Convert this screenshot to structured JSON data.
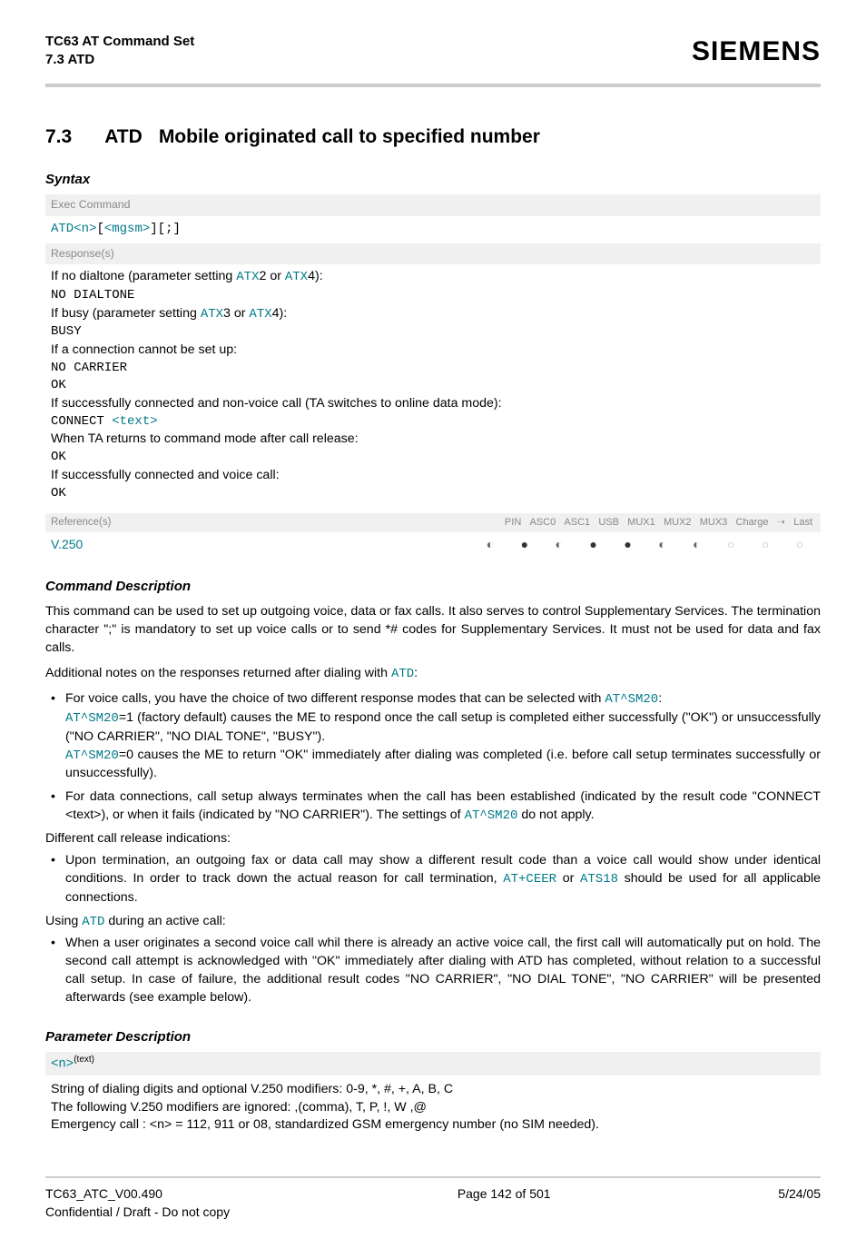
{
  "header": {
    "line1": "TC63 AT Command Set",
    "line2": "7.3 ATD",
    "brand": "SIEMENS"
  },
  "title": {
    "num": "7.3",
    "cmd": "ATD",
    "desc": "Mobile originated call to specified number"
  },
  "syntax_label": "Syntax",
  "exec_command_label": "Exec Command",
  "exec_command": {
    "cmd": "ATD",
    "p1": "<n>",
    "b1": "[",
    "p2": "<mgsm>",
    "b2": "][;]"
  },
  "responses_label": "Response(s)",
  "resp": {
    "l1a": "If no dialtone (parameter setting ",
    "l1b": "2 or ",
    "l1c": "4):",
    "atx": "ATX",
    "no_dialtone": "NO DIALTONE",
    "l2a": "If busy (parameter setting ",
    "l2b": "3 or ",
    "l2c": "4):",
    "busy": "BUSY",
    "l3": "If a connection cannot be set up:",
    "no_carrier": "NO CARRIER",
    "ok1": "OK",
    "l4": "If successfully connected and non-voice call (TA switches to online data mode):",
    "connect": "CONNECT ",
    "text_tag": "<text>",
    "l5": "When TA returns to command mode after call release:",
    "ok2": "OK",
    "l6": "If successfully connected and voice call:",
    "ok3": "OK"
  },
  "ref": {
    "label": "Reference(s)",
    "cols": [
      "PIN",
      "ASC0",
      "ASC1",
      "USB",
      "MUX1",
      "MUX2",
      "MUX3",
      "Charge",
      "➝",
      "Last"
    ],
    "name": "V.250",
    "vals": [
      "◐",
      "●",
      "◐",
      "●",
      "●",
      "◐",
      "◐",
      "○",
      "○",
      "○"
    ]
  },
  "cmd_desc_label": "Command Description",
  "cmd_desc_p1": "This command can be used to set up outgoing voice, data or fax calls. It also serves to control Supplementary Services. The termination character \";\" is mandatory to set up voice calls or to send *# codes for Supplementary Services. It must not be used for data and fax calls.",
  "cmd_desc_p2a": "Additional notes on the responses returned after dialing with ",
  "cmd_desc_p2b": ":",
  "atd": "ATD",
  "at_sm20": "AT^SM20",
  "at_ceer": "AT+CEER",
  "ats18": "ATS18",
  "bul1": {
    "a": "For voice calls, you have the choice of two different response modes that can be selected with ",
    "b": ":",
    "c": "=1 (factory default) causes the ME to respond once the call setup is completed either successfully (\"OK\") or unsuccessfully (\"NO CARRIER\", \"NO DIAL TONE\", \"BUSY\").",
    "d": "=0 causes the ME to return \"OK\" immediately after dialing was completed (i.e. before call setup terminates successfully or unsuccessfully)."
  },
  "bul2": {
    "a": "For data connections, call setup always terminates when the call has been established (indicated by the result code \"CONNECT <text>), or when it fails (indicated by \"NO CARRIER\"). The settings of ",
    "b": " do not apply."
  },
  "diff_rel": "Different call release indications:",
  "bul3": {
    "a": "Upon termination, an outgoing fax or data call may show a different result code than a voice call would show under identical conditions. In order to track down the actual reason for call termination, ",
    "b": " or ",
    "c": " should be used for all applicable connections."
  },
  "using_a": "Using ",
  "using_b": " during an active call:",
  "bul4": "When a user originates a second voice call whil there is already an active voice call, the first call will automatically put on hold. The second call attempt is acknowledged with \"OK\" immediately after dialing with ATD has completed, without relation to a successful call setup. In case of failure, the additional result codes \"NO CARRIER\", \"NO DIAL TONE\", \"NO CARRIER\" will be presented afterwards (see example below).",
  "param_desc_label": "Parameter Description",
  "param_n": "<n>",
  "param_n_sup": "(text)",
  "param_n_desc": {
    "l1": "String of dialing digits and optional V.250 modifiers: 0-9, *, #, +, A, B, C",
    "l2": "The following V.250 modifiers are ignored: ,(comma), T, P, !, W ,@",
    "l3": "Emergency call : <n> = 112, 911 or 08, standardized GSM emergency number (no SIM needed)."
  },
  "footer": {
    "left": "TC63_ATC_V00.490",
    "center": "Page 142 of 501",
    "right": "5/24/05",
    "conf": "Confidential / Draft - Do not copy"
  }
}
